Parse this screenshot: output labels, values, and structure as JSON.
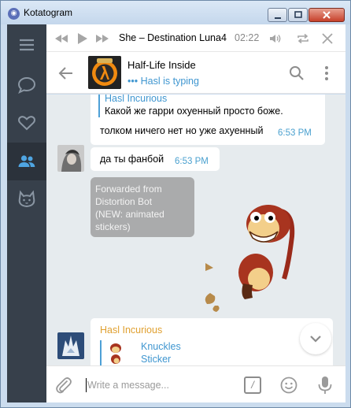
{
  "window": {
    "title": "Kotatogram",
    "logo": "cat-logo",
    "buttons": {
      "minimize": "minimize-icon",
      "maximize": "maximize-icon",
      "close": "close-icon"
    }
  },
  "sidebar": {
    "items": [
      {
        "icon": "hamburger-menu-icon",
        "active": false
      },
      {
        "icon": "chat-bubble-icon",
        "active": false
      },
      {
        "icon": "heart-icon",
        "active": false
      },
      {
        "icon": "people-icon",
        "active": true
      },
      {
        "icon": "cat-icon",
        "active": false
      }
    ],
    "colors": {
      "background": "#37404b",
      "active": "#2b323b",
      "icon": "#8a96a3",
      "icon_active": "#4fa5e2"
    }
  },
  "player": {
    "track": "She – Destination Luna4",
    "time": "02:22"
  },
  "chat": {
    "title": "Half-Life Inside",
    "status": "Hasl is typing",
    "typing_indicator": "•••"
  },
  "messages": {
    "first": {
      "reply_name": "Hasl Incurious",
      "reply_text": "Какой же гарри охуенный просто боже.",
      "text": "толком ничего нет но уже ахуенный",
      "time": "6:53 PM"
    },
    "second": {
      "text": "да ты фанбой",
      "time": "6:53 PM"
    },
    "forwarded": {
      "lines": [
        "Forwarded from",
        "Distortion Bot",
        "(NEW: animated",
        "stickers)"
      ]
    },
    "last": {
      "sender": "Hasl Incurious",
      "reply_name": "Knuckles",
      "reply_text": "Sticker"
    }
  },
  "composer": {
    "placeholder": "Write a message...",
    "command_glyph": "/"
  },
  "colors": {
    "accent": "#3f96d0",
    "chat_background": "#e6ebee",
    "service_bubble": "#969696"
  }
}
